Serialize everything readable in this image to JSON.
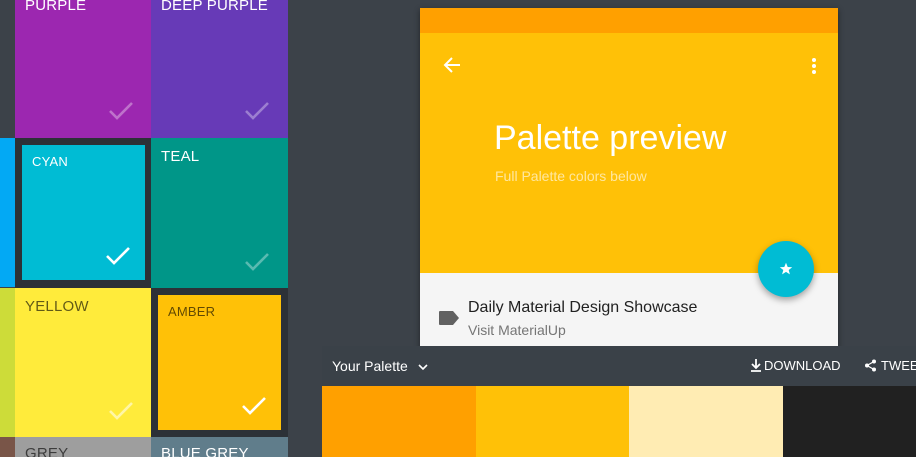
{
  "colors": {
    "background": "#3c4249",
    "purple": "#9c27b0",
    "deep_purple": "#673ab7",
    "blue_stripe": "#03a9f4",
    "cyan": "#00bcd4",
    "teal": "#009688",
    "lime_stripe": "#cddc39",
    "yellow": "#ffeb3b",
    "amber": "#ffc107",
    "grey": "#9e9e9e",
    "blue_grey": "#607d8b",
    "brown_stripe": "#795548",
    "status_bar": "#ffa000",
    "app_bar": "#ffc107",
    "fab": "#00bcd4",
    "swatch_1": "#ffa000",
    "swatch_2": "#ffc107",
    "swatch_3": "#ffecb3",
    "swatch_4": "#212121"
  },
  "color_grid": {
    "tiles": [
      {
        "label": "PURPLE",
        "selected": false
      },
      {
        "label": "DEEP PURPLE",
        "selected": false
      },
      {
        "label": "CYAN",
        "selected": true
      },
      {
        "label": "TEAL",
        "selected": false
      },
      {
        "label": "YELLOW",
        "selected": false
      },
      {
        "label": "AMBER",
        "selected": true
      },
      {
        "label": "GREY",
        "selected": false
      },
      {
        "label": "BLUE GREY",
        "selected": false
      }
    ],
    "check_icon": "check-icon"
  },
  "preview": {
    "back_icon": "arrow-back-icon",
    "menu_icon": "more-vert-icon",
    "title": "Palette preview",
    "subtitle": "Full Palette colors below",
    "fab_icon": "star-icon",
    "list_item": {
      "icon": "label-icon",
      "title": "Daily Material Design Showcase",
      "subtitle": "Visit MaterialUp"
    }
  },
  "palette_bar": {
    "title": "Your Palette",
    "dropdown_icon": "chevron-down-icon",
    "download_icon": "download-icon",
    "download_label": "DOWNLOAD",
    "share_icon": "share-icon",
    "tweet_label": "TWEET"
  }
}
